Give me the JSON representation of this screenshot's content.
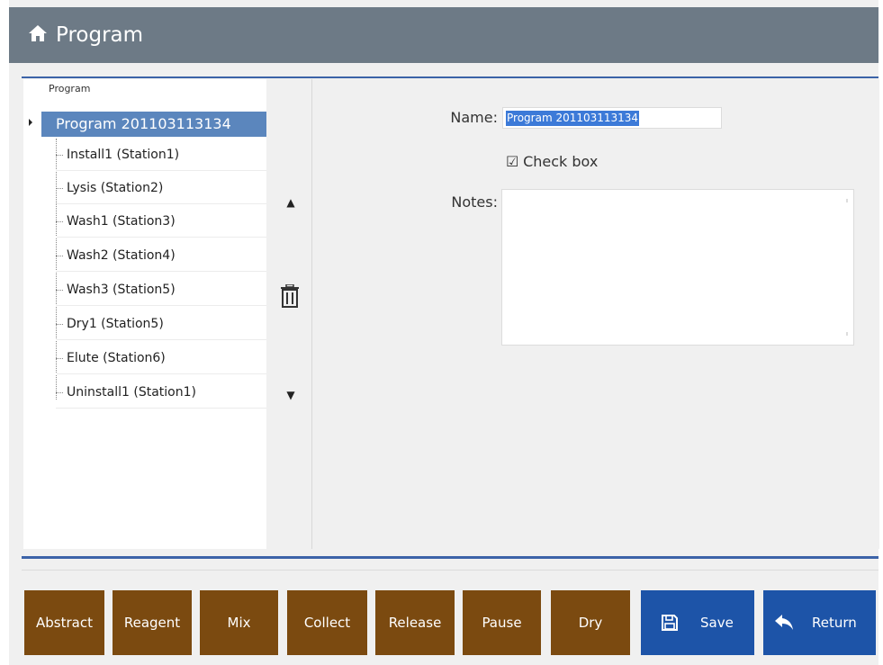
{
  "header": {
    "title": "Program",
    "icon": "home-icon"
  },
  "tree": {
    "root_label": "Program",
    "selected": "Program 201103113134",
    "items": [
      "Install1 (Station1)",
      "Lysis (Station2)",
      "Wash1 (Station3)",
      "Wash2 (Station4)",
      "Wash3 (Station5)",
      "Dry1 (Station5)",
      "Elute (Station6)",
      "Uninstall1 (Station1)"
    ]
  },
  "controls": {
    "up": "▲",
    "down": "▼",
    "delete_icon": "trash-icon"
  },
  "form": {
    "name_label": "Name:",
    "name_value": "Program 201103113134",
    "checkbox_label": "Check box",
    "checkbox_checked": true,
    "notes_label": "Notes:",
    "notes_value": ""
  },
  "toolbar": {
    "buttons": [
      "Abstract",
      "Reagent",
      "Mix",
      "Collect",
      "Release",
      "Pause",
      "Dry"
    ],
    "save_label": "Save",
    "return_label": "Return"
  },
  "colors": {
    "header_bg": "#6d7a86",
    "accent_blue": "#1d54a8",
    "selection_blue": "#5b86bd",
    "button_brown": "#7b4a10"
  }
}
